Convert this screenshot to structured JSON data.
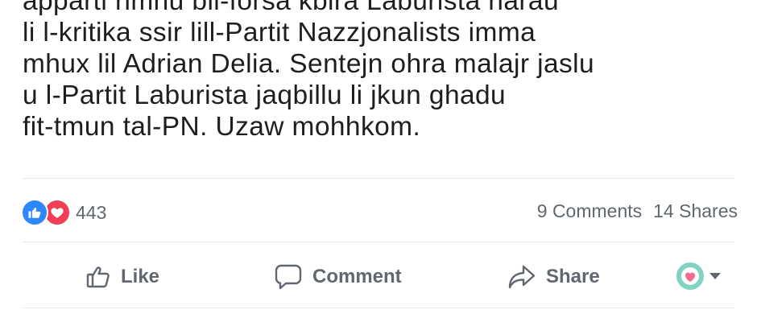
{
  "post": {
    "text_lines": [
      "apparti rimhu bil-forsa kbira Laburista harau",
      "li l-kritika ssir lill-Partit Nazzjonalists imma",
      "mhux lil Adrian Delia. Sentejn ohra malajr jaslu",
      "u l-Partit Laburista jaqbillu li jkun ghadu",
      "fit-tmun tal-PN. Uzaw mohhkom."
    ]
  },
  "engagement": {
    "reaction_icons": [
      "like-reaction-icon",
      "love-reaction-icon"
    ],
    "reaction_count": "443",
    "comments": "9 Comments",
    "shares": "14 Shares"
  },
  "actions": {
    "like_label": "Like",
    "comment_label": "Comment",
    "share_label": "Share",
    "icons": [
      "thumbs-up-icon",
      "speech-bubble-icon",
      "share-arrow-icon"
    ]
  },
  "audience_selector": {
    "icon": "reaction-avatar-icon",
    "caret": "caret-down-icon"
  },
  "colors": {
    "text": "#1c1e21",
    "secondary_text": "#606770",
    "like_blue": "#2d88ff",
    "love_red": "#f33e58",
    "divider": "#e4e6ea",
    "avatar_teal": "#7fd3c0"
  }
}
